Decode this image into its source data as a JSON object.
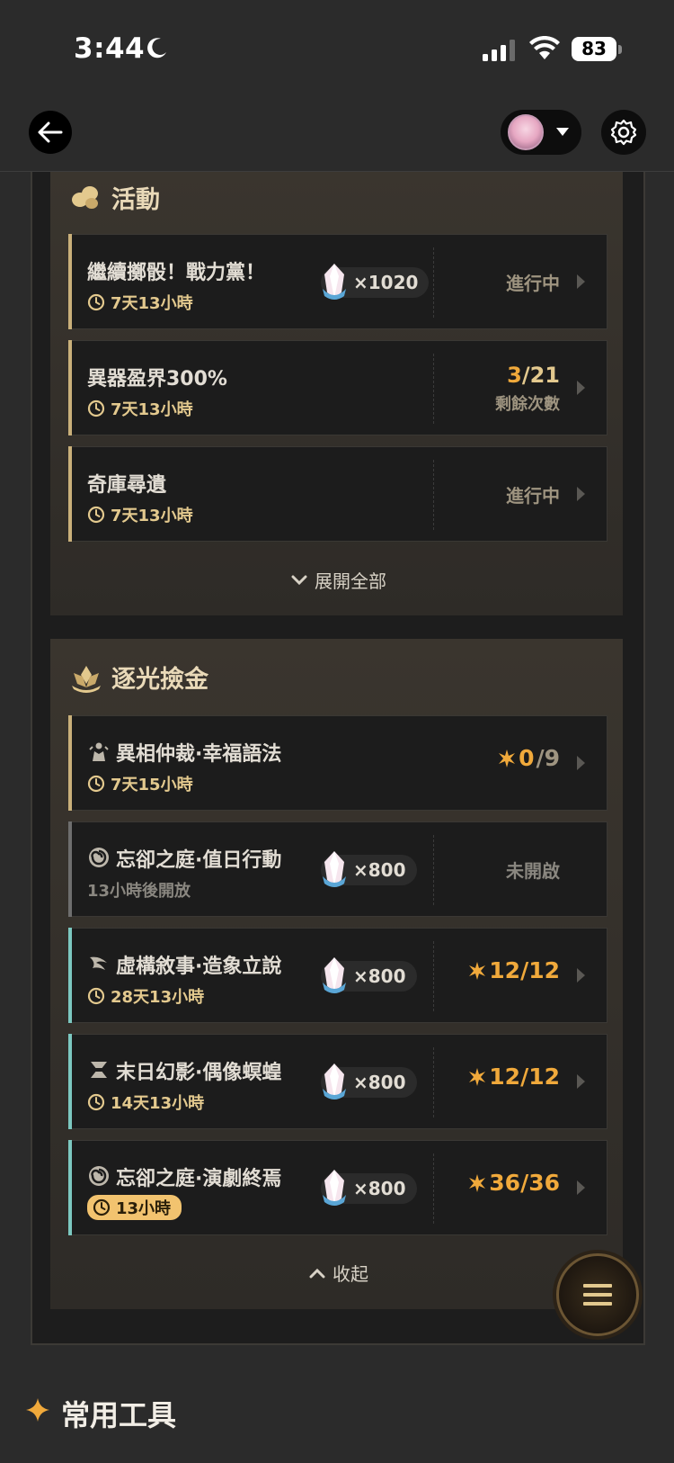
{
  "status_bar": {
    "time": "3:44",
    "battery": "83"
  },
  "events_section": {
    "title": "活動",
    "rows": [
      {
        "title": "繼續擲骰！戰力黨！",
        "time": "7天13小時",
        "reward": "×1020",
        "status": "進行中"
      },
      {
        "title": "異器盈界300%",
        "time": "7天13小時",
        "count_current": "3",
        "count_total": "/21",
        "count_label": "剩餘次數"
      },
      {
        "title": "奇庫尋遺",
        "time": "7天13小時",
        "status": "進行中"
      }
    ],
    "expand_label": "展開全部"
  },
  "gold_section": {
    "title": "逐光撿金",
    "rows": [
      {
        "title": "異相仲裁·幸福語法",
        "time": "7天15小時",
        "stars_current": "0",
        "stars_total": "/9",
        "icon": "arbiter-icon"
      },
      {
        "title": "忘卻之庭·值日行動",
        "time": "13小時後開放",
        "reward": "×800",
        "status": "未開啟",
        "icon": "swirl-icon"
      },
      {
        "title": "虛構敘事·造象立說",
        "time": "28天13小時",
        "reward": "×800",
        "stars": "12/12",
        "icon": "fiction-icon"
      },
      {
        "title": "末日幻影·偶像螟蝗",
        "time": "14天13小時",
        "reward": "×800",
        "stars": "12/12",
        "icon": "apocalyptic-icon"
      },
      {
        "title": "忘卻之庭·演劇終焉",
        "time": "13小時",
        "reward": "×800",
        "stars": "36/36",
        "icon": "swirl-icon"
      }
    ],
    "collapse_label": "收起"
  },
  "tools": {
    "title": "常用工具"
  },
  "colors": {
    "accent_gold": "#e3c98e",
    "star_orange": "#f0a93b",
    "teal": "#7cc8c0"
  }
}
